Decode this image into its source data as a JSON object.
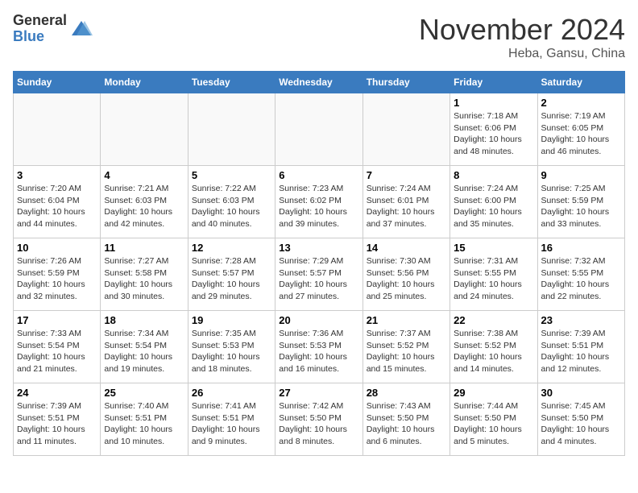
{
  "header": {
    "logo_general": "General",
    "logo_blue": "Blue",
    "month_title": "November 2024",
    "location": "Heba, Gansu, China"
  },
  "weekdays": [
    "Sunday",
    "Monday",
    "Tuesday",
    "Wednesday",
    "Thursday",
    "Friday",
    "Saturday"
  ],
  "weeks": [
    [
      {
        "day": "",
        "info": ""
      },
      {
        "day": "",
        "info": ""
      },
      {
        "day": "",
        "info": ""
      },
      {
        "day": "",
        "info": ""
      },
      {
        "day": "",
        "info": ""
      },
      {
        "day": "1",
        "info": "Sunrise: 7:18 AM\nSunset: 6:06 PM\nDaylight: 10 hours\nand 48 minutes."
      },
      {
        "day": "2",
        "info": "Sunrise: 7:19 AM\nSunset: 6:05 PM\nDaylight: 10 hours\nand 46 minutes."
      }
    ],
    [
      {
        "day": "3",
        "info": "Sunrise: 7:20 AM\nSunset: 6:04 PM\nDaylight: 10 hours\nand 44 minutes."
      },
      {
        "day": "4",
        "info": "Sunrise: 7:21 AM\nSunset: 6:03 PM\nDaylight: 10 hours\nand 42 minutes."
      },
      {
        "day": "5",
        "info": "Sunrise: 7:22 AM\nSunset: 6:03 PM\nDaylight: 10 hours\nand 40 minutes."
      },
      {
        "day": "6",
        "info": "Sunrise: 7:23 AM\nSunset: 6:02 PM\nDaylight: 10 hours\nand 39 minutes."
      },
      {
        "day": "7",
        "info": "Sunrise: 7:24 AM\nSunset: 6:01 PM\nDaylight: 10 hours\nand 37 minutes."
      },
      {
        "day": "8",
        "info": "Sunrise: 7:24 AM\nSunset: 6:00 PM\nDaylight: 10 hours\nand 35 minutes."
      },
      {
        "day": "9",
        "info": "Sunrise: 7:25 AM\nSunset: 5:59 PM\nDaylight: 10 hours\nand 33 minutes."
      }
    ],
    [
      {
        "day": "10",
        "info": "Sunrise: 7:26 AM\nSunset: 5:59 PM\nDaylight: 10 hours\nand 32 minutes."
      },
      {
        "day": "11",
        "info": "Sunrise: 7:27 AM\nSunset: 5:58 PM\nDaylight: 10 hours\nand 30 minutes."
      },
      {
        "day": "12",
        "info": "Sunrise: 7:28 AM\nSunset: 5:57 PM\nDaylight: 10 hours\nand 29 minutes."
      },
      {
        "day": "13",
        "info": "Sunrise: 7:29 AM\nSunset: 5:57 PM\nDaylight: 10 hours\nand 27 minutes."
      },
      {
        "day": "14",
        "info": "Sunrise: 7:30 AM\nSunset: 5:56 PM\nDaylight: 10 hours\nand 25 minutes."
      },
      {
        "day": "15",
        "info": "Sunrise: 7:31 AM\nSunset: 5:55 PM\nDaylight: 10 hours\nand 24 minutes."
      },
      {
        "day": "16",
        "info": "Sunrise: 7:32 AM\nSunset: 5:55 PM\nDaylight: 10 hours\nand 22 minutes."
      }
    ],
    [
      {
        "day": "17",
        "info": "Sunrise: 7:33 AM\nSunset: 5:54 PM\nDaylight: 10 hours\nand 21 minutes."
      },
      {
        "day": "18",
        "info": "Sunrise: 7:34 AM\nSunset: 5:54 PM\nDaylight: 10 hours\nand 19 minutes."
      },
      {
        "day": "19",
        "info": "Sunrise: 7:35 AM\nSunset: 5:53 PM\nDaylight: 10 hours\nand 18 minutes."
      },
      {
        "day": "20",
        "info": "Sunrise: 7:36 AM\nSunset: 5:53 PM\nDaylight: 10 hours\nand 16 minutes."
      },
      {
        "day": "21",
        "info": "Sunrise: 7:37 AM\nSunset: 5:52 PM\nDaylight: 10 hours\nand 15 minutes."
      },
      {
        "day": "22",
        "info": "Sunrise: 7:38 AM\nSunset: 5:52 PM\nDaylight: 10 hours\nand 14 minutes."
      },
      {
        "day": "23",
        "info": "Sunrise: 7:39 AM\nSunset: 5:51 PM\nDaylight: 10 hours\nand 12 minutes."
      }
    ],
    [
      {
        "day": "24",
        "info": "Sunrise: 7:39 AM\nSunset: 5:51 PM\nDaylight: 10 hours\nand 11 minutes."
      },
      {
        "day": "25",
        "info": "Sunrise: 7:40 AM\nSunset: 5:51 PM\nDaylight: 10 hours\nand 10 minutes."
      },
      {
        "day": "26",
        "info": "Sunrise: 7:41 AM\nSunset: 5:51 PM\nDaylight: 10 hours\nand 9 minutes."
      },
      {
        "day": "27",
        "info": "Sunrise: 7:42 AM\nSunset: 5:50 PM\nDaylight: 10 hours\nand 8 minutes."
      },
      {
        "day": "28",
        "info": "Sunrise: 7:43 AM\nSunset: 5:50 PM\nDaylight: 10 hours\nand 6 minutes."
      },
      {
        "day": "29",
        "info": "Sunrise: 7:44 AM\nSunset: 5:50 PM\nDaylight: 10 hours\nand 5 minutes."
      },
      {
        "day": "30",
        "info": "Sunrise: 7:45 AM\nSunset: 5:50 PM\nDaylight: 10 hours\nand 4 minutes."
      }
    ]
  ]
}
